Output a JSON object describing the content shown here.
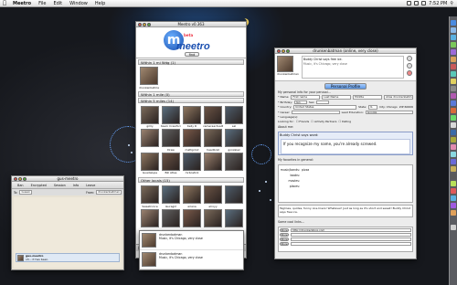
{
  "menubar": {
    "apple": "",
    "app_name": "Meetro",
    "items": [
      "File",
      "Edit",
      "Window",
      "Help"
    ],
    "clock": "7:52 PM"
  },
  "meetro": {
    "title": "Meetro v0.363",
    "logo_letter": "m",
    "logo_word": "meetro",
    "logo_beta": "beta",
    "find_button": "find",
    "section_nearby": "Within 1 mi Wdg (1)",
    "self_name": "drunkenbatman",
    "section_1mile": "Within 1 mile (0)",
    "section_5miles": "Within 5 miles (14)",
    "section_other": "Other locals (15)",
    "nearby_users": [
      "grilly",
      "Kevin Crawford",
      "Kelly R",
      "cameraactuality",
      "sal",
      "",
      "Drew",
      "mattgrind",
      "headbrat",
      "gonzalez",
      "Guadalupe",
      "Bill Atlas",
      "mrbostick",
      "",
      ""
    ],
    "other_users": [
      "Sweetnnice",
      "lauragirl",
      "ariana",
      "elroyy",
      "",
      "",
      "",
      "",
      "",
      ""
    ],
    "status": "Online"
  },
  "mini": {
    "rows": [
      {
        "name": "drunkenbatman",
        "text": "Music, it's Chicago, very close"
      },
      {
        "name": "drunkenbatman",
        "text": "Music, it's Chicago, very close"
      }
    ]
  },
  "profile": {
    "title": "drunkenbatman (online, very close)",
    "status_text": "Buddy Christ says free ice.",
    "name_under_avatar": "drunkenbatman",
    "status_sub": "Music, it's Chicago, very close",
    "tab": "Personal Profile",
    "personal_label": "My personal info for your perusal...",
    "fields": {
      "name_lbl": "* Name:",
      "first": "First name",
      "last": "Last Name",
      "middle": "Middle",
      "alias": "Alias drunkenbatman",
      "birthday_lbl": "* Birthday:",
      "birthday": "Jan",
      "sex_lbl": "Sex:",
      "sex": "",
      "country_lbl": "* Country:",
      "country": "United States",
      "state_lbl": "State:",
      "state": "IL",
      "city_lbl": "City: Chicago",
      "zip_lbl": "ZIP 60606",
      "career_lbl": "* Career:",
      "career": "",
      "lang_lbl": "Lead Education:",
      "lang": "Google",
      "languages_lbl": "* Language(s):",
      "looking_lbl": "Looking for:",
      "friends": "Friends",
      "activity": "Activity Partners",
      "dating": "Dating"
    },
    "about_label": "About me:",
    "says_title": "Buddy Christ says word:",
    "says_text": "If you recognize my name, you're already screwed.",
    "favorites_label": "My favorites in general:",
    "favorites": [
      {
        "k": "music/bands:",
        "v": "pizza"
      },
      {
        "k": "books:",
        "v": ""
      },
      {
        "k": "movies:",
        "v": ""
      },
      {
        "k": "places:",
        "v": ""
      }
    ],
    "tags_text": "Taglines, quotes, funny one-liners! Whatever! Just as long as it's short and sweet! Buddy Christ says free ice.",
    "links_label": "Some cool links...",
    "links": [
      {
        "btn": "Store",
        "url": "http://drunkenblog.com"
      },
      {
        "btn": "Store",
        "url": ""
      },
      {
        "btn": "Store",
        "url": ""
      },
      {
        "btn": "Store",
        "url": ""
      }
    ]
  },
  "chat": {
    "title": "gus-meetro",
    "toolbar": [
      "Ban",
      "Encrypted",
      "Session",
      "Info",
      "Leave"
    ],
    "to_label": "To:",
    "to_value": "Gusan",
    "from_label": "From:",
    "from_value": "drunkenbatman",
    "msg_name": "gus-meetro",
    "msg_text": "oh... it has been."
  },
  "colors": {
    "accent": "#5b97e6",
    "logo_blue": "#1a4fb0",
    "desktop": "#1a1c22"
  }
}
